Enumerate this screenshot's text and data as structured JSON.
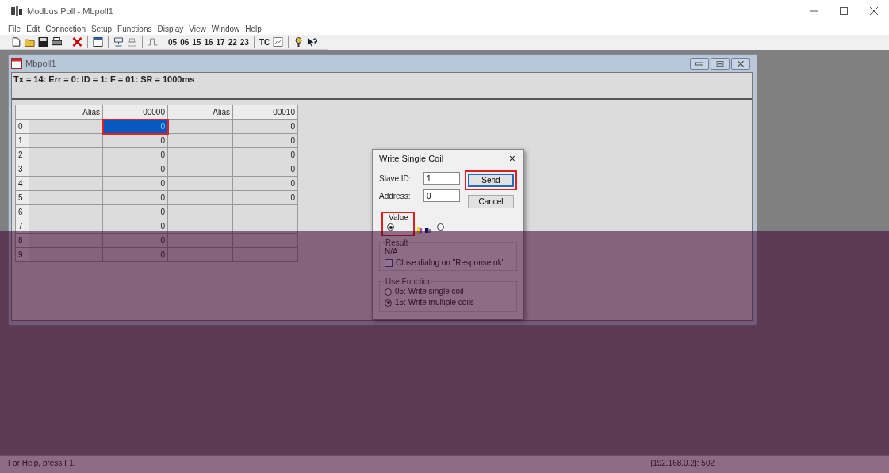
{
  "window": {
    "title": "Modbus Poll - Mbpoll1"
  },
  "menu": [
    "File",
    "Edit",
    "Connection",
    "Setup",
    "Functions",
    "Display",
    "View",
    "Window",
    "Help"
  ],
  "toolbar": {
    "function_codes": [
      "05",
      "06",
      "15",
      "16",
      "17",
      "22",
      "23"
    ],
    "tc_label": "TC"
  },
  "child_window": {
    "title": "Mbpoll1",
    "status_line": "Tx = 14: Err = 0: ID = 1: F = 01: SR = 1000ms"
  },
  "table": {
    "columns": [
      "Alias",
      "00000",
      "Alias",
      "00010"
    ],
    "rows": [
      {
        "label": "0",
        "values": [
          "0",
          "0"
        ],
        "selected": true
      },
      {
        "label": "1",
        "values": [
          "0",
          "0"
        ],
        "selected": false
      },
      {
        "label": "2",
        "values": [
          "0",
          "0"
        ],
        "selected": false
      },
      {
        "label": "3",
        "values": [
          "0",
          "0"
        ],
        "selected": false
      },
      {
        "label": "4",
        "values": [
          "0",
          "0"
        ],
        "selected": false
      },
      {
        "label": "5",
        "values": [
          "0",
          "0"
        ],
        "selected": false
      },
      {
        "label": "6",
        "values": [
          "0"
        ],
        "selected": false
      },
      {
        "label": "7",
        "values": [
          "0"
        ],
        "selected": false
      },
      {
        "label": "8",
        "values": [
          "0"
        ],
        "selected": false
      },
      {
        "label": "9",
        "values": [
          "0"
        ],
        "selected": false
      }
    ]
  },
  "dialog": {
    "title": "Write Single Coil",
    "close": "×",
    "fields": [
      {
        "label": "Slave ID:",
        "value": "1"
      },
      {
        "label": "Address:",
        "value": "0"
      }
    ],
    "buttons": [
      {
        "label": "Send",
        "highlighted": true
      },
      {
        "label": "Cancel",
        "highlighted": false
      }
    ],
    "value_group": {
      "label": "Value",
      "options": [
        {
          "selected": true
        },
        {
          "selected": false
        }
      ]
    },
    "result_group": {
      "label": "Result",
      "text": "N/A",
      "checkbox": {
        "label": "Close dialog on \"Response ok\"",
        "checked": false
      }
    },
    "function_group": {
      "label": "Use Function",
      "options": [
        {
          "label": "05: Write single coil",
          "selected": false
        },
        {
          "label": "15: Write multiple coils",
          "selected": true
        }
      ]
    }
  },
  "status_bar": {
    "help": "For Help, press F1.",
    "connection": "[192.168.0.2]: 502"
  }
}
